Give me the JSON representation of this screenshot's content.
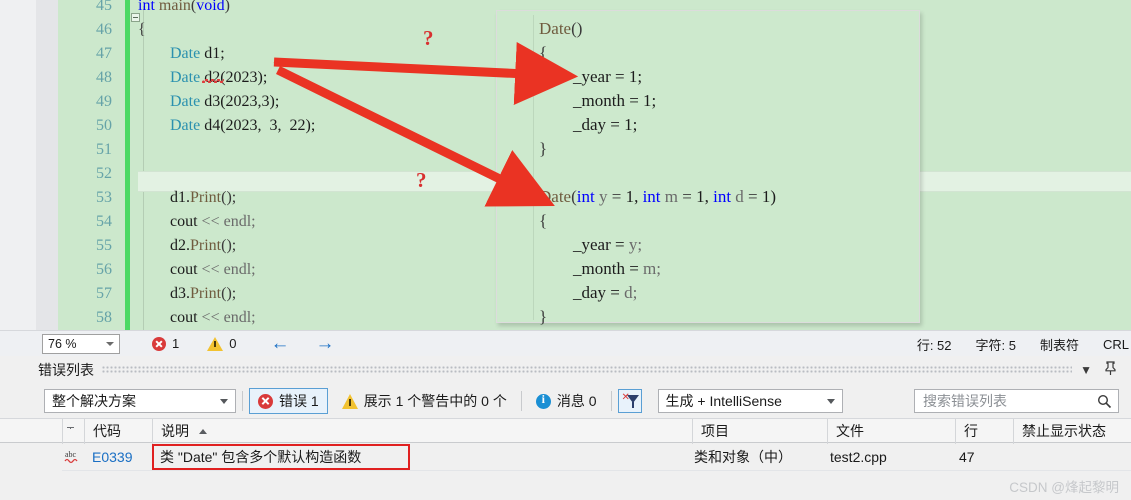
{
  "editor": {
    "language": "cpp",
    "first_partial_line": "44",
    "lines": [
      {
        "num": "45",
        "indent": 0,
        "tokens": [
          {
            "t": "int ",
            "c": "kw"
          },
          {
            "t": "main",
            "c": "fn"
          },
          {
            "t": "(",
            "c": "op"
          },
          {
            "t": "void",
            "c": "kw"
          },
          {
            "t": ")",
            "c": "op"
          }
        ],
        "fold": true
      },
      {
        "num": "46",
        "indent": 0,
        "tokens": [
          {
            "t": "{",
            "c": "op"
          }
        ]
      },
      {
        "num": "47",
        "indent": 1,
        "tokens": [
          {
            "t": "Date",
            "c": "type"
          },
          {
            "t": " d1;",
            "c": "id"
          }
        ],
        "squiggle": true
      },
      {
        "num": "48",
        "indent": 1,
        "tokens": [
          {
            "t": "Date",
            "c": "type"
          },
          {
            "t": " d2(2023);",
            "c": "id"
          }
        ]
      },
      {
        "num": "49",
        "indent": 1,
        "tokens": [
          {
            "t": "Date",
            "c": "type"
          },
          {
            "t": " d3(2023,3);",
            "c": "id"
          }
        ]
      },
      {
        "num": "50",
        "indent": 1,
        "tokens": [
          {
            "t": "Date",
            "c": "type"
          },
          {
            "t": " d4(2023,  3,  22);",
            "c": "id"
          }
        ]
      },
      {
        "num": "51",
        "indent": 0,
        "tokens": []
      },
      {
        "num": "52",
        "indent": 0,
        "tokens": [],
        "current": true
      },
      {
        "num": "53",
        "indent": 1,
        "tokens": [
          {
            "t": "d1.",
            "c": "id"
          },
          {
            "t": "Print",
            "c": "fn"
          },
          {
            "t": "();",
            "c": "op"
          }
        ]
      },
      {
        "num": "54",
        "indent": 1,
        "tokens": [
          {
            "t": "cout ",
            "c": "id"
          },
          {
            "t": "<< ",
            "c": "param"
          },
          {
            "t": "endl;",
            "c": "param"
          }
        ]
      },
      {
        "num": "55",
        "indent": 1,
        "tokens": [
          {
            "t": "d2.",
            "c": "id"
          },
          {
            "t": "Print",
            "c": "fn"
          },
          {
            "t": "();",
            "c": "op"
          }
        ]
      },
      {
        "num": "56",
        "indent": 1,
        "tokens": [
          {
            "t": "cout ",
            "c": "id"
          },
          {
            "t": "<< ",
            "c": "param"
          },
          {
            "t": "endl;",
            "c": "param"
          }
        ]
      },
      {
        "num": "57",
        "indent": 1,
        "tokens": [
          {
            "t": "d3.",
            "c": "id"
          },
          {
            "t": "Print",
            "c": "fn"
          },
          {
            "t": "();",
            "c": "op"
          }
        ]
      },
      {
        "num": "58",
        "indent": 1,
        "tokens": [
          {
            "t": "cout ",
            "c": "id"
          },
          {
            "t": "<< ",
            "c": "param"
          },
          {
            "t": "endl;",
            "c": "param"
          }
        ]
      }
    ]
  },
  "snippet": {
    "lines": [
      {
        "indent": 0,
        "tokens": [
          {
            "t": "Date",
            "c": "fn"
          },
          {
            "t": "()",
            "c": "op"
          }
        ]
      },
      {
        "indent": 0,
        "tokens": [
          {
            "t": "{",
            "c": "op"
          }
        ]
      },
      {
        "indent": 1,
        "tokens": [
          {
            "t": "_year = ",
            "c": "id"
          },
          {
            "t": "1;",
            "c": "num"
          }
        ]
      },
      {
        "indent": 1,
        "tokens": [
          {
            "t": "_month = ",
            "c": "id"
          },
          {
            "t": "1;",
            "c": "num"
          }
        ]
      },
      {
        "indent": 1,
        "tokens": [
          {
            "t": "_day = ",
            "c": "id"
          },
          {
            "t": "1;",
            "c": "num"
          }
        ]
      },
      {
        "indent": 0,
        "tokens": [
          {
            "t": "}",
            "c": "op"
          }
        ]
      },
      {
        "indent": 0,
        "tokens": []
      },
      {
        "indent": 0,
        "tokens": [
          {
            "t": "Date",
            "c": "fn"
          },
          {
            "t": "(",
            "c": "op"
          },
          {
            "t": "int",
            "c": "kw"
          },
          {
            "t": " y ",
            "c": "param"
          },
          {
            "t": "= ",
            "c": "op"
          },
          {
            "t": "1, ",
            "c": "num"
          },
          {
            "t": "int",
            "c": "kw"
          },
          {
            "t": " m ",
            "c": "param"
          },
          {
            "t": "= ",
            "c": "op"
          },
          {
            "t": "1, ",
            "c": "num"
          },
          {
            "t": "int",
            "c": "kw"
          },
          {
            "t": " d ",
            "c": "param"
          },
          {
            "t": "= ",
            "c": "op"
          },
          {
            "t": "1)",
            "c": "num"
          }
        ]
      },
      {
        "indent": 0,
        "tokens": [
          {
            "t": "{",
            "c": "op"
          }
        ]
      },
      {
        "indent": 1,
        "tokens": [
          {
            "t": "_year = ",
            "c": "id"
          },
          {
            "t": "y;",
            "c": "param"
          }
        ]
      },
      {
        "indent": 1,
        "tokens": [
          {
            "t": "_month = ",
            "c": "id"
          },
          {
            "t": "m;",
            "c": "param"
          }
        ]
      },
      {
        "indent": 1,
        "tokens": [
          {
            "t": "_day = ",
            "c": "id"
          },
          {
            "t": "d;",
            "c": "param"
          }
        ]
      },
      {
        "indent": 0,
        "tokens": [
          {
            "t": "}",
            "c": "op"
          }
        ]
      }
    ]
  },
  "annotations": {
    "accent_color": "#ea3323",
    "question_mark_1": "?",
    "question_mark_2": "?"
  },
  "statusbar": {
    "zoom": "76 %",
    "error_count": "1",
    "warning_count": "0",
    "prev_label": "←",
    "next_label": "→",
    "line_label": "行: 52",
    "char_label": "字符: 5",
    "tab_label": "制表符",
    "eol_label": "CRL"
  },
  "panel": {
    "title": "错误列表",
    "chevron": "▼",
    "pin": "⚲",
    "toolbar": {
      "scope": "整个解决方案",
      "errors_label": "错误 1",
      "warnings_label": "展示 1 个警告中的 0 个",
      "messages_label": "消息 0",
      "build_filter": "生成 + IntelliSense",
      "search_placeholder": "搜索错误列表"
    },
    "columns": [
      {
        "key": "code",
        "label": "代码"
      },
      {
        "key": "description",
        "label": "说明",
        "sorted": true
      },
      {
        "key": "project",
        "label": "项目"
      },
      {
        "key": "file",
        "label": "文件"
      },
      {
        "key": "line",
        "label": "行"
      },
      {
        "key": "suppression",
        "label": "禁止显示状态"
      }
    ],
    "rows": [
      {
        "code": "E0339",
        "description": "类 \"Date\" 包含多个默认构造函数",
        "project": "类和对象（中）",
        "file": "test2.cpp",
        "line": "47",
        "suppression": ""
      }
    ]
  },
  "watermark": "CSDN @烽起黎明"
}
